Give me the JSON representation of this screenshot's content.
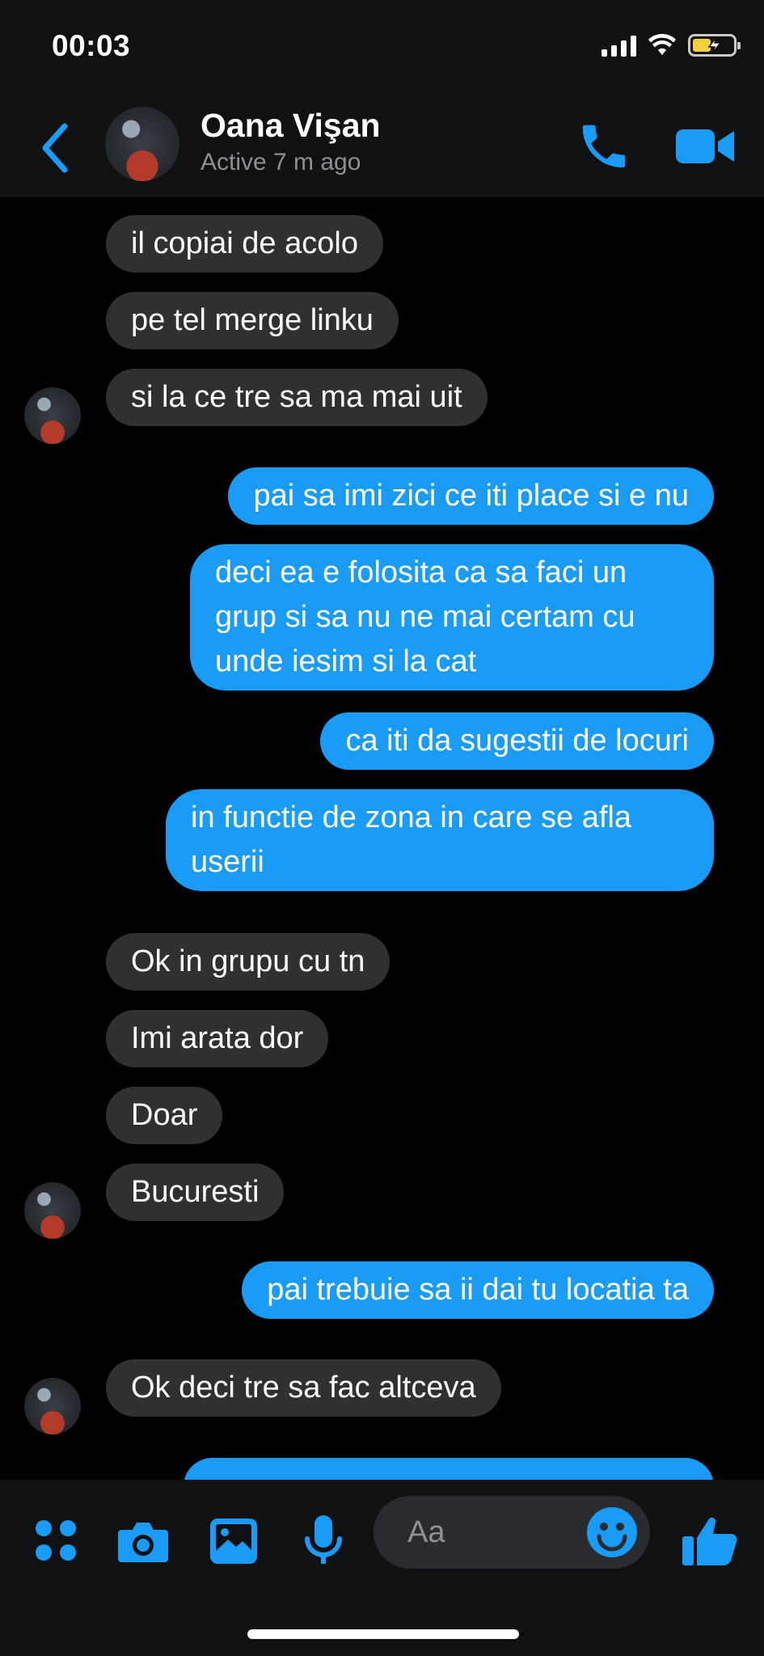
{
  "status_bar": {
    "time": "00:03"
  },
  "header": {
    "contact_name": "Oana Vişan",
    "contact_status": "Active 7 m ago"
  },
  "messages": [
    {
      "side": "in",
      "text": "il copiai de acolo"
    },
    {
      "side": "in",
      "text": "pe tel merge linku"
    },
    {
      "side": "in",
      "text": "si la ce tre sa ma mai uit"
    },
    {
      "side": "out",
      "text": "pai sa imi zici ce iti place si e nu"
    },
    {
      "side": "out",
      "text": "deci ea e folosita ca sa faci un grup si sa nu ne mai certam cu unde iesim si la cat"
    },
    {
      "side": "out",
      "text": "ca iti da sugestii de locuri"
    },
    {
      "side": "out",
      "text": "in functie de zona in care se afla userii"
    },
    {
      "side": "in",
      "text": "Ok in grupu cu tn"
    },
    {
      "side": "in",
      "text": "Imi arata dor"
    },
    {
      "side": "in",
      "text": "Doar"
    },
    {
      "side": "in",
      "text": "Bucuresti"
    },
    {
      "side": "out",
      "text": "pai trebuie sa ii dai tu locatia ta"
    },
    {
      "side": "in",
      "text": "Ok deci tre sa fac altceva"
    }
  ],
  "composer": {
    "placeholder": "Aa"
  },
  "colors": {
    "accent": "#1a9bf5",
    "incoming_bubble": "#303032",
    "background": "#000000"
  },
  "icons": {
    "header": [
      "back-chevron-icon",
      "phone-icon",
      "video-camera-icon"
    ],
    "composer": [
      "apps-grid-icon",
      "camera-icon",
      "image-icon",
      "microphone-icon",
      "emoji-icon",
      "thumbs-up-icon"
    ]
  }
}
